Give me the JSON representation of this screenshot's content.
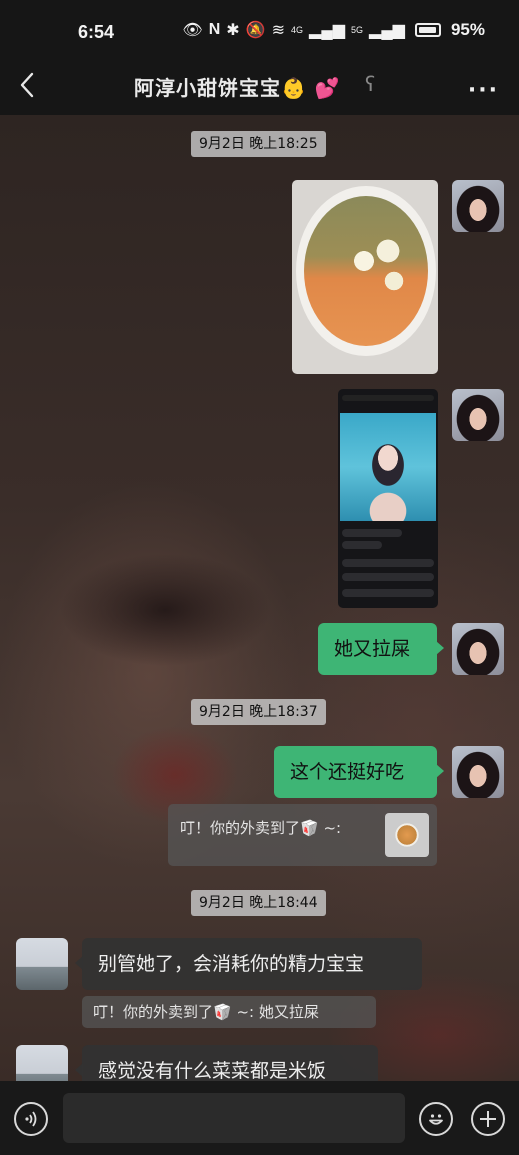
{
  "status_bar": {
    "time": "6:54",
    "signal_4g": "4G",
    "signal_5g": "5G",
    "battery": "95%"
  },
  "header": {
    "title": "阿淳小甜饼宝宝👶 💕",
    "more": "···"
  },
  "timestamps": {
    "t1": "9月2日 晚上18:25",
    "t2": "9月2日 晚上18:37",
    "t3": "9月2日 晚上18:44"
  },
  "messages": {
    "m1": "她又拉屎",
    "m2": "这个还挺好吃",
    "quote1": "叮！你的外卖到了🥡 ~:",
    "m3": "别管她了，会消耗你的精力宝宝",
    "quote2": "叮！你的外卖到了🥡 ~:  她又拉屎",
    "m4": "感觉没有什么菜菜都是米饭"
  },
  "icons": {
    "back": "chevron-left-icon",
    "ear": "ear-icon",
    "voice": "voice-icon",
    "emoji": "emoji-icon",
    "add": "plus-icon"
  },
  "colors": {
    "me_bubble": "#3eb575",
    "them_bubble": "#323232",
    "topbar": "#161616"
  }
}
